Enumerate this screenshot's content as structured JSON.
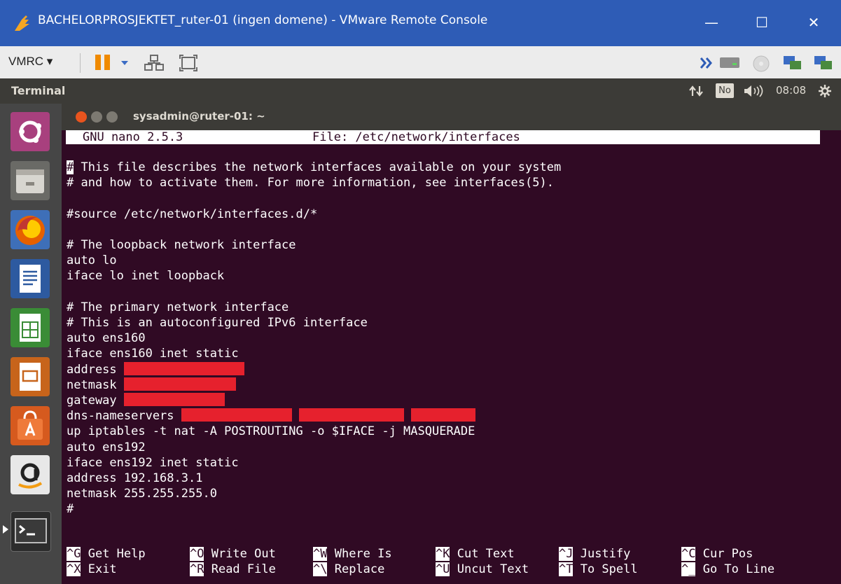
{
  "window": {
    "title": "BACHELORPROSJEKTET_ruter-01 (ingen domene) - VMware Remote Console",
    "minimize": "—",
    "maximize": "☐",
    "close": "✕"
  },
  "toolbar": {
    "menu_label": "VMRC",
    "menu_arrow": "▾"
  },
  "panel": {
    "app_name": "Terminal",
    "keyboard_badge": "No",
    "time": "08:08"
  },
  "terminal": {
    "title": "sysadmin@ruter-01: ~"
  },
  "nano": {
    "version": "GNU nano 2.5.3",
    "file_label": "File: /etc/network/interfaces",
    "cursor_char": "#",
    "lines": [
      " This file describes the network interfaces available on your system",
      "# and how to activate them. For more information, see interfaces(5).",
      "",
      "#source /etc/network/interfaces.d/*",
      "",
      "# The loopback network interface",
      "auto lo",
      "iface lo inet loopback",
      "",
      "# The primary network interface",
      "# This is an autoconfigured IPv6 interface",
      "auto ens160",
      "iface ens160 inet static",
      "address ",
      "netmask ",
      "gateway ",
      "dns-nameservers ",
      "up iptables -t nat -A POSTROUTING -o $IFACE -j MASQUERADE",
      "auto ens192",
      "iface ens192 inet static",
      "address 192.168.3.1",
      "netmask 255.255.255.0",
      "#"
    ],
    "shortcuts": [
      {
        "key": "^G",
        "label": " Get Help"
      },
      {
        "key": "^O",
        "label": " Write Out"
      },
      {
        "key": "^W",
        "label": " Where Is"
      },
      {
        "key": "^K",
        "label": " Cut Text"
      },
      {
        "key": "^J",
        "label": " Justify"
      },
      {
        "key": "^C",
        "label": " Cur Pos"
      },
      {
        "key": "^X",
        "label": " Exit"
      },
      {
        "key": "^R",
        "label": " Read File"
      },
      {
        "key": "^\\",
        "label": " Replace"
      },
      {
        "key": "^U",
        "label": " Uncut Text"
      },
      {
        "key": "^T",
        "label": " To Spell"
      },
      {
        "key": "^_",
        "label": " Go To Line"
      }
    ]
  },
  "colors": {
    "terminal_bg": "#300a24",
    "redaction": "#e6212d",
    "vmware_titlebar": "#2e5cb6"
  },
  "launcher": {
    "items": [
      "ubuntu-dash-icon",
      "files-icon",
      "firefox-icon",
      "writer-icon",
      "calc-icon",
      "impress-icon",
      "software-center-icon",
      "amazon-icon",
      "terminal-icon"
    ]
  }
}
